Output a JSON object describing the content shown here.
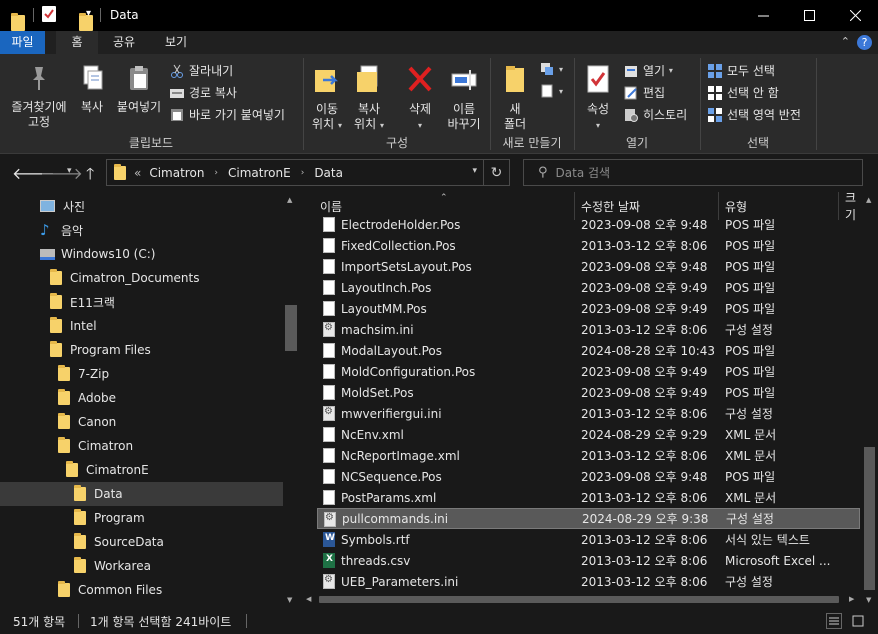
{
  "window": {
    "title": "Data"
  },
  "tabs": [
    "파일",
    "홈",
    "공유",
    "보기"
  ],
  "ribbon": {
    "clipboard": {
      "pin_label_1": "즐겨찾기에",
      "pin_label_2": "고정",
      "copy_label": "복사",
      "paste_label": "붙여넣기",
      "cut_label": "잘라내기",
      "copy_path_label": "경로 복사",
      "paste_shortcut_label": "바로 가기 붙여넣기",
      "group_label": "클립보드"
    },
    "organize": {
      "move_label_1": "이동",
      "move_label_2": "위치",
      "copyto_label_1": "복사",
      "copyto_label_2": "위치",
      "delete_label": "삭제",
      "rename_label_1": "이름",
      "rename_label_2": "바꾸기",
      "group_label": "구성"
    },
    "new": {
      "new_folder_label_1": "새",
      "new_folder_label_2": "폴더",
      "group_label": "새로 만들기"
    },
    "open": {
      "properties_label": "속성",
      "open_label": "열기",
      "edit_label": "편집",
      "history_label": "히스토리",
      "group_label": "열기"
    },
    "select": {
      "select_all_label": "모두 선택",
      "select_none_label": "선택 안 함",
      "invert_label": "선택 영역 반전",
      "group_label": "선택"
    }
  },
  "address": {
    "overflow": "«",
    "crumbs": [
      "Cimatron",
      "CimatronE",
      "Data"
    ]
  },
  "search": {
    "placeholder": "Data 검색"
  },
  "tree": [
    {
      "label": "사진",
      "icon": "pictures-icon"
    },
    {
      "label": "음악",
      "icon": "music-icon"
    },
    {
      "label": "Windows10 (C:)",
      "icon": "drive-icon"
    },
    {
      "label": "Cimatron_Documents",
      "icon": "folder-icon"
    },
    {
      "label": "E11크랙",
      "icon": "folder-icon"
    },
    {
      "label": "Intel",
      "icon": "folder-icon"
    },
    {
      "label": "Program Files",
      "icon": "folder-icon"
    },
    {
      "label": "7-Zip",
      "icon": "folder-icon"
    },
    {
      "label": "Adobe",
      "icon": "folder-icon"
    },
    {
      "label": "Canon",
      "icon": "folder-icon"
    },
    {
      "label": "Cimatron",
      "icon": "folder-icon"
    },
    {
      "label": "CimatronE",
      "icon": "folder-icon"
    },
    {
      "label": "Data",
      "icon": "folder-icon"
    },
    {
      "label": "Program",
      "icon": "folder-icon"
    },
    {
      "label": "SourceData",
      "icon": "folder-icon"
    },
    {
      "label": "Workarea",
      "icon": "folder-icon"
    },
    {
      "label": "Common Files",
      "icon": "folder-icon"
    }
  ],
  "columns": {
    "name": "이름",
    "date": "수정한 날짜",
    "type": "유형",
    "size": "크기"
  },
  "files": [
    {
      "name": "ElectrodeHolder.Pos",
      "date": "2023-09-08 오후 9:48",
      "type": "POS 파일",
      "kind": "file"
    },
    {
      "name": "FixedCollection.Pos",
      "date": "2013-03-12 오후 8:06",
      "type": "POS 파일",
      "kind": "file"
    },
    {
      "name": "ImportSetsLayout.Pos",
      "date": "2023-09-08 오후 9:48",
      "type": "POS 파일",
      "kind": "file"
    },
    {
      "name": "LayoutInch.Pos",
      "date": "2023-09-08 오후 9:49",
      "type": "POS 파일",
      "kind": "file"
    },
    {
      "name": "LayoutMM.Pos",
      "date": "2023-09-08 오후 9:49",
      "type": "POS 파일",
      "kind": "file"
    },
    {
      "name": "machsim.ini",
      "date": "2013-03-12 오후 8:06",
      "type": "구성 설정",
      "kind": "ini"
    },
    {
      "name": "ModalLayout.Pos",
      "date": "2024-08-28 오후 10:43",
      "type": "POS 파일",
      "kind": "file"
    },
    {
      "name": "MoldConfiguration.Pos",
      "date": "2023-09-08 오후 9:49",
      "type": "POS 파일",
      "kind": "file"
    },
    {
      "name": "MoldSet.Pos",
      "date": "2023-09-08 오후 9:49",
      "type": "POS 파일",
      "kind": "file"
    },
    {
      "name": "mwverifiergui.ini",
      "date": "2013-03-12 오후 8:06",
      "type": "구성 설정",
      "kind": "ini"
    },
    {
      "name": "NcEnv.xml",
      "date": "2024-08-29 오후 9:29",
      "type": "XML 문서",
      "kind": "file"
    },
    {
      "name": "NcReportImage.xml",
      "date": "2013-03-12 오후 8:06",
      "type": "XML 문서",
      "kind": "file"
    },
    {
      "name": "NCSequence.Pos",
      "date": "2023-09-08 오후 9:48",
      "type": "POS 파일",
      "kind": "file"
    },
    {
      "name": "PostParams.xml",
      "date": "2013-03-12 오후 8:06",
      "type": "XML 문서",
      "kind": "file"
    },
    {
      "name": "pullcommands.ini",
      "date": "2024-08-29 오후 9:38",
      "type": "구성 설정",
      "kind": "ini"
    },
    {
      "name": "Symbols.rtf",
      "date": "2013-03-12 오후 8:06",
      "type": "서식 있는 텍스트",
      "kind": "rtf"
    },
    {
      "name": "threads.csv",
      "date": "2013-03-12 오후 8:06",
      "type": "Microsoft Excel ...",
      "kind": "csv"
    },
    {
      "name": "UEB_Parameters.ini",
      "date": "2013-03-12 오후 8:06",
      "type": "구성 설정",
      "kind": "ini"
    }
  ],
  "selected_file": "pullcommands.ini",
  "status": {
    "count": "51개 항목",
    "selection": "1개 항목 선택함 241바이트"
  }
}
